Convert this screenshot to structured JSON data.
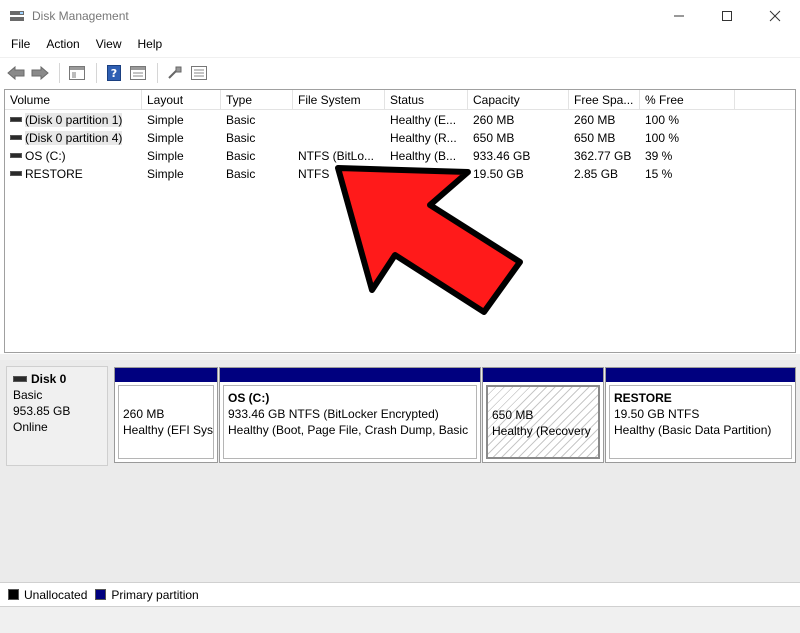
{
  "window": {
    "title": "Disk Management"
  },
  "menu": [
    "File",
    "Action",
    "View",
    "Help"
  ],
  "volume_list": {
    "columns": [
      "Volume",
      "Layout",
      "Type",
      "File System",
      "Status",
      "Capacity",
      "Free Spa...",
      "% Free"
    ],
    "rows": [
      {
        "volume": "(Disk 0 partition 1)",
        "layout": "Simple",
        "type": "Basic",
        "fs": "",
        "status": "Healthy (E...",
        "capacity": "260 MB",
        "free": "260 MB",
        "pct": "100 %"
      },
      {
        "volume": "(Disk 0 partition 4)",
        "layout": "Simple",
        "type": "Basic",
        "fs": "",
        "status": "Healthy (R...",
        "capacity": "650 MB",
        "free": "650 MB",
        "pct": "100 %"
      },
      {
        "volume": "OS (C:)",
        "layout": "Simple",
        "type": "Basic",
        "fs": "NTFS (BitLo...",
        "status": "Healthy (B...",
        "capacity": "933.46 GB",
        "free": "362.77 GB",
        "pct": "39 %"
      },
      {
        "volume": "RESTORE",
        "layout": "Simple",
        "type": "Basic",
        "fs": "NTFS",
        "status": "",
        "capacity": "19.50 GB",
        "free": "2.85 GB",
        "pct": "15 %"
      }
    ]
  },
  "disk": {
    "name": "Disk 0",
    "type": "Basic",
    "size": "953.85 GB",
    "state": "Online",
    "partitions": [
      {
        "name": "",
        "size": "260 MB",
        "status": "Healthy (EFI Sys"
      },
      {
        "name": "OS  (C:)",
        "size": "933.46 GB NTFS (BitLocker Encrypted)",
        "status": "Healthy (Boot, Page File, Crash Dump, Basic"
      },
      {
        "name": "",
        "size": "650 MB",
        "status": "Healthy (Recovery"
      },
      {
        "name": "RESTORE",
        "size": "19.50 GB NTFS",
        "status": "Healthy (Basic Data Partition)"
      }
    ]
  },
  "legend": [
    {
      "label": "Unallocated",
      "color": "#000000"
    },
    {
      "label": "Primary partition",
      "color": "#00007f"
    }
  ],
  "colors": {
    "partition_bar": "#00007f",
    "arrow_fill": "#ff1a1a",
    "arrow_stroke": "#000000"
  }
}
